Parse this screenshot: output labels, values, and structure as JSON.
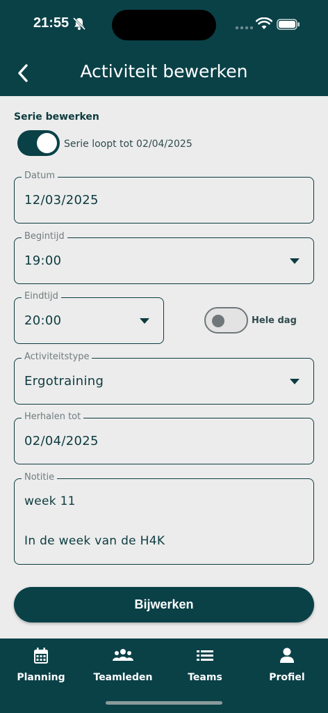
{
  "status_bar": {
    "time": "21:55"
  },
  "header": {
    "title": "Activiteit bewerken"
  },
  "series": {
    "section_label": "Serie bewerken",
    "toggle_text": "Serie loopt tot 02/04/2025",
    "toggle_on": true
  },
  "fields": {
    "datum": {
      "label": "Datum",
      "value": "12/03/2025"
    },
    "begintijd": {
      "label": "Begintijd",
      "value": "19:00"
    },
    "eindtijd": {
      "label": "Eindtijd",
      "value": "20:00"
    },
    "hele_dag": {
      "label": "Hele dag",
      "on": false
    },
    "activiteitstype": {
      "label": "Activiteitstype",
      "value": "Ergotraining"
    },
    "herhalen_tot": {
      "label": "Herhalen tot",
      "value": "02/04/2025"
    },
    "notitie": {
      "label": "Notitie",
      "lines": [
        "week 11",
        "In de week van de H4K"
      ]
    }
  },
  "submit": {
    "label": "Bijwerken"
  },
  "tabbar": {
    "items": [
      {
        "label": "Planning",
        "icon": "calendar-icon"
      },
      {
        "label": "Teamleden",
        "icon": "people-icon"
      },
      {
        "label": "Teams",
        "icon": "list-icon"
      },
      {
        "label": "Profiel",
        "icon": "person-icon"
      }
    ]
  },
  "colors": {
    "primary": "#0a4147",
    "background": "#ececec",
    "text": "#0d3b3f"
  }
}
